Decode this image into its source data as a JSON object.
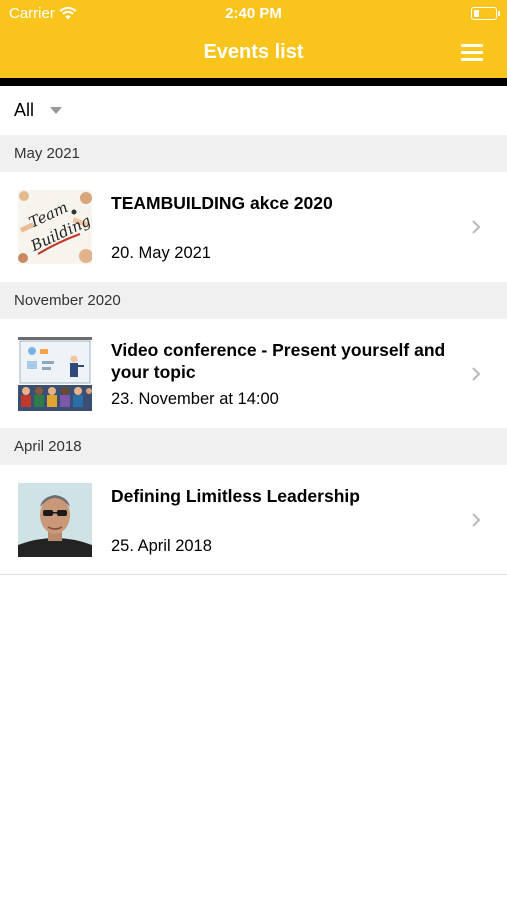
{
  "status_bar": {
    "carrier": "Carrier",
    "time": "2:40 PM",
    "battery_level": 0.25
  },
  "header": {
    "title": "Events list",
    "menu_icon": "hamburger-icon",
    "background": "#f9c51c"
  },
  "filter": {
    "value": "All"
  },
  "sections": [
    {
      "label": "May 2021",
      "events": [
        {
          "title": "TEAMBUILDING akce 2020",
          "date": "20. May 2021",
          "thumbnail": "team-building-image"
        }
      ]
    },
    {
      "label": "November 2020",
      "events": [
        {
          "title": "Video conference - Present yourself and your topic",
          "date": "23. November at 14:00",
          "thumbnail": "conference-presentation-image"
        }
      ]
    },
    {
      "label": "April 2018",
      "events": [
        {
          "title": "Defining Limitless Leadership",
          "date": "25. April 2018",
          "thumbnail": "speaker-portrait-image"
        }
      ]
    }
  ]
}
